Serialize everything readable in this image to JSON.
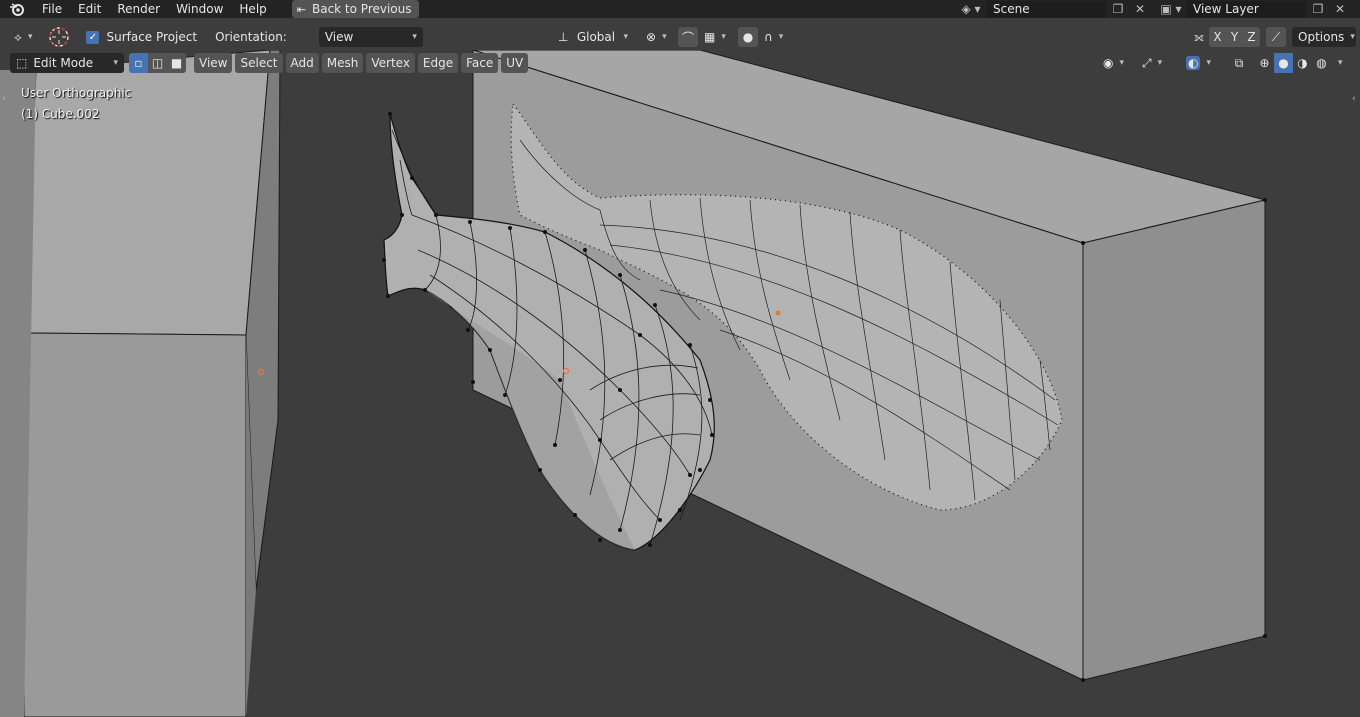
{
  "topbar": {
    "menu": [
      "File",
      "Edit",
      "Render",
      "Window",
      "Help"
    ],
    "back_label": "Back to Previous",
    "scene_value": "Scene",
    "view_layer_value": "View Layer"
  },
  "toolhdr": {
    "surface_project_label": "Surface Project",
    "surface_project_checked": true,
    "orientation_label": "Orientation:",
    "orientation_value": "View",
    "transform_orientation": "Global",
    "axes": [
      "X",
      "Y",
      "Z"
    ],
    "options_label": "Options"
  },
  "viewport": {
    "mode_value": "Edit Mode",
    "menu": [
      "View",
      "Select",
      "Add",
      "Mesh",
      "Vertex",
      "Edge",
      "Face",
      "UV"
    ],
    "view_name": "User Orthographic",
    "object_name": "(1) Cube.002"
  },
  "colors": {
    "accent": "#4772b3",
    "background": "#3d3d3d",
    "mesh_face": "#9a9a9a",
    "origin_dot": "#e07a3a"
  }
}
